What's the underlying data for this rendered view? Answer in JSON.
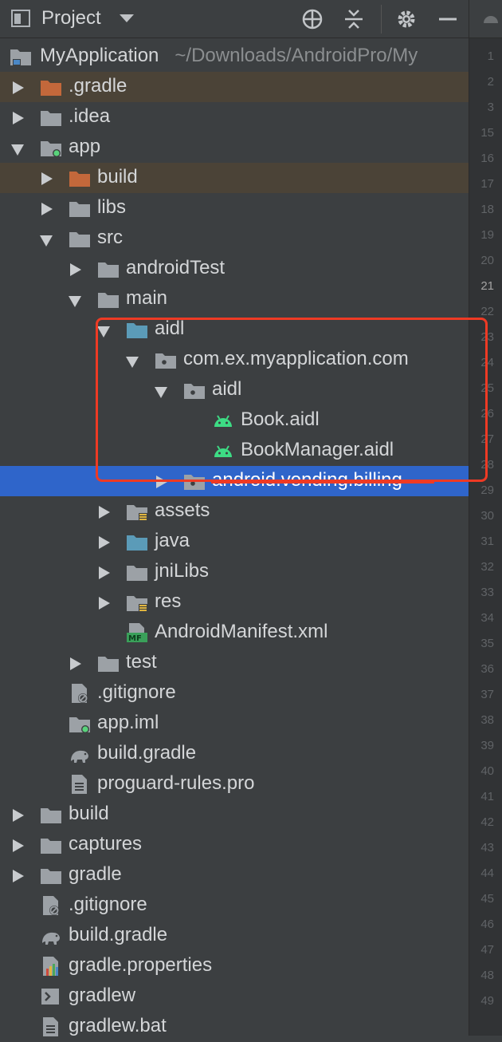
{
  "toolbar": {
    "title": "Project",
    "view_mode_icon": "chevron-down-icon"
  },
  "root": {
    "name": "MyApplication",
    "path": "~/Downloads/AndroidPro/My"
  },
  "tree": [
    {
      "name": "gradle-dir",
      "label": ".gradle",
      "indent": 0,
      "arrow": "right",
      "icon": "folder-orange",
      "hl": "brown"
    },
    {
      "name": "idea-dir",
      "label": ".idea",
      "indent": 0,
      "arrow": "right",
      "icon": "folder"
    },
    {
      "name": "app-module",
      "label": "app",
      "indent": 0,
      "arrow": "down",
      "icon": "folder-module"
    },
    {
      "name": "build-dir",
      "label": "build",
      "indent": 1,
      "arrow": "right",
      "icon": "folder-orange",
      "hl": "brown"
    },
    {
      "name": "libs-dir",
      "label": "libs",
      "indent": 1,
      "arrow": "right",
      "icon": "folder"
    },
    {
      "name": "src-dir",
      "label": "src",
      "indent": 1,
      "arrow": "down",
      "icon": "folder"
    },
    {
      "name": "androidtest-dir",
      "label": "androidTest",
      "indent": 2,
      "arrow": "right",
      "icon": "folder"
    },
    {
      "name": "main-dir",
      "label": "main",
      "indent": 2,
      "arrow": "down",
      "icon": "folder"
    },
    {
      "name": "aidl-dir",
      "label": "aidl",
      "indent": 3,
      "arrow": "down",
      "icon": "folder-blue"
    },
    {
      "name": "package-dir",
      "label": "com.ex.myapplication.com",
      "indent": 4,
      "arrow": "down",
      "icon": "folder-package"
    },
    {
      "name": "aidl-package-dir",
      "label": "aidl",
      "indent": 5,
      "arrow": "down",
      "icon": "folder-package"
    },
    {
      "name": "book-aidl-file",
      "label": "Book.aidl",
      "indent": 6,
      "arrow": "none",
      "icon": "android"
    },
    {
      "name": "bookmanager-aidl-file",
      "label": "BookManager.aidl",
      "indent": 6,
      "arrow": "none",
      "icon": "android"
    },
    {
      "name": "vending-billing-dir",
      "label": "android.vending.billing",
      "indent": 5,
      "arrow": "right",
      "icon": "folder-package",
      "hl": "blue"
    },
    {
      "name": "assets-dir",
      "label": "assets",
      "indent": 3,
      "arrow": "right",
      "icon": "folder-res"
    },
    {
      "name": "java-dir",
      "label": "java",
      "indent": 3,
      "arrow": "right",
      "icon": "folder-blue"
    },
    {
      "name": "jnilibs-dir",
      "label": "jniLibs",
      "indent": 3,
      "arrow": "right",
      "icon": "folder"
    },
    {
      "name": "res-dir",
      "label": "res",
      "indent": 3,
      "arrow": "right",
      "icon": "folder-res"
    },
    {
      "name": "manifest-file",
      "label": "AndroidManifest.xml",
      "indent": 3,
      "arrow": "none",
      "icon": "manifest"
    },
    {
      "name": "test-dir",
      "label": "test",
      "indent": 2,
      "arrow": "right",
      "icon": "folder"
    },
    {
      "name": "app-gitignore-file",
      "label": ".gitignore",
      "indent": 1,
      "arrow": "none",
      "icon": "ignore"
    },
    {
      "name": "app-iml-file",
      "label": "app.iml",
      "indent": 1,
      "arrow": "none",
      "icon": "folder-module"
    },
    {
      "name": "app-build-gradle-file",
      "label": "build.gradle",
      "indent": 1,
      "arrow": "none",
      "icon": "gradle"
    },
    {
      "name": "proguard-file",
      "label": "proguard-rules.pro",
      "indent": 1,
      "arrow": "none",
      "icon": "text"
    },
    {
      "name": "root-build-dir",
      "label": "build",
      "indent": 0,
      "arrow": "right",
      "icon": "folder"
    },
    {
      "name": "captures-dir",
      "label": "captures",
      "indent": 0,
      "arrow": "right",
      "icon": "folder"
    },
    {
      "name": "gradle-dir-root",
      "label": "gradle",
      "indent": 0,
      "arrow": "right",
      "icon": "folder"
    },
    {
      "name": "root-gitignore-file",
      "label": ".gitignore",
      "indent": 0,
      "arrow": "none",
      "icon": "ignore"
    },
    {
      "name": "root-build-gradle-file",
      "label": "build.gradle",
      "indent": 0,
      "arrow": "none",
      "icon": "gradle"
    },
    {
      "name": "gradle-properties-file",
      "label": "gradle.properties",
      "indent": 0,
      "arrow": "none",
      "icon": "properties"
    },
    {
      "name": "gradlew-file",
      "label": "gradlew",
      "indent": 0,
      "arrow": "none",
      "icon": "shell"
    },
    {
      "name": "gradlew-bat-file",
      "label": "gradlew.bat",
      "indent": 0,
      "arrow": "none",
      "icon": "text"
    }
  ],
  "line_numbers": [
    "1",
    "2",
    "3",
    "15",
    "16",
    "17",
    "18",
    "19",
    "20",
    "21",
    "22",
    "23",
    "24",
    "25",
    "26",
    "27",
    "28",
    "29",
    "30",
    "31",
    "32",
    "33",
    "34",
    "35",
    "36",
    "37",
    "38",
    "39",
    "40",
    "41",
    "42",
    "43",
    "44",
    "45",
    "46",
    "47",
    "48",
    "49"
  ],
  "current_line": "21",
  "colors": {
    "selection": "#2f65ca",
    "excluded": "#4b4337",
    "annotation": "#ee3a24",
    "android": "#3ddc84"
  }
}
